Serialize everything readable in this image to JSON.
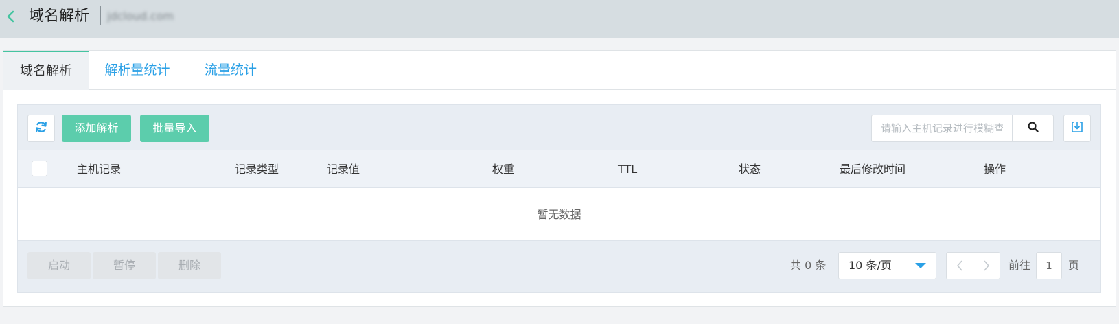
{
  "header": {
    "title": "域名解析",
    "domain": "jdcloud.com"
  },
  "tabs": [
    {
      "label": "域名解析",
      "active": true
    },
    {
      "label": "解析量统计",
      "active": false
    },
    {
      "label": "流量统计",
      "active": false
    }
  ],
  "toolbar": {
    "add_label": "添加解析",
    "import_label": "批量导入",
    "search_placeholder": "请输入主机记录进行模糊查询",
    "refresh_icon": "refresh-icon",
    "search_icon": "search-icon",
    "download_icon": "download-icon"
  },
  "table": {
    "columns": [
      "主机记录",
      "记录类型",
      "记录值",
      "权重",
      "TTL",
      "状态",
      "最后修改时间",
      "操作"
    ],
    "rows": [],
    "empty_text": "暂无数据"
  },
  "footer": {
    "actions": [
      "启动",
      "暂停",
      "删除"
    ],
    "total_text": "共 0 条",
    "page_size": "10 条/页",
    "goto_label": "前往",
    "current_page": "1",
    "page_suffix": "页"
  },
  "colors": {
    "accent_green": "#5ccdac",
    "link_blue": "#2aa0e6",
    "topbar_bg": "#d6dde1"
  }
}
